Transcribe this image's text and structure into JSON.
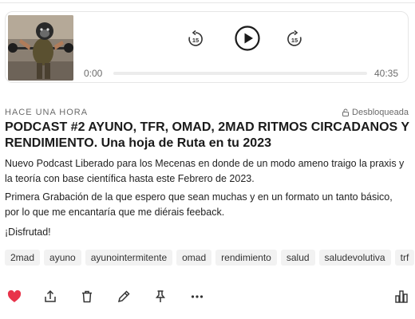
{
  "player": {
    "current_time": "0:00",
    "total_time": "40:35",
    "progress_percent": 0,
    "skip_back_seconds": "15",
    "skip_forward_seconds": "15"
  },
  "post": {
    "timestamp": "HACE UNA HORA",
    "status": "Desbloqueada",
    "title": "PODCAST #2 AYUNO, TFR, OMAD, 2MAD RITMOS CIRCADANOS Y RENDIMIENTO. Una hoja de Ruta en tu 2023",
    "paragraphs": [
      "Nuevo Podcast Liberado para los Mecenas en donde de un modo ameno traigo la praxis y la teoría con base científica hasta este Febrero de 2023.",
      "Primera Grabación de la que espero que sean muchas y en un formato un tanto básico, por lo que me encantaría que me diérais feeback.",
      "¡Disfrutad!"
    ],
    "tags": [
      "2mad",
      "ayuno",
      "ayunointermitente",
      "omad",
      "rendimiento",
      "salud",
      "saludevolutiva",
      "trf"
    ]
  },
  "colors": {
    "like": "#e8334a",
    "text": "#1a1a1a",
    "muted": "#6b6b6b",
    "tag_bg": "#f2f2f2"
  },
  "icons": [
    "like-heart-icon",
    "share-icon",
    "delete-trash-icon",
    "edit-pencil-icon",
    "pin-icon",
    "more-dots-icon",
    "stats-chart-icon",
    "unlock-icon",
    "skip-back-icon",
    "play-icon",
    "skip-forward-icon"
  ]
}
